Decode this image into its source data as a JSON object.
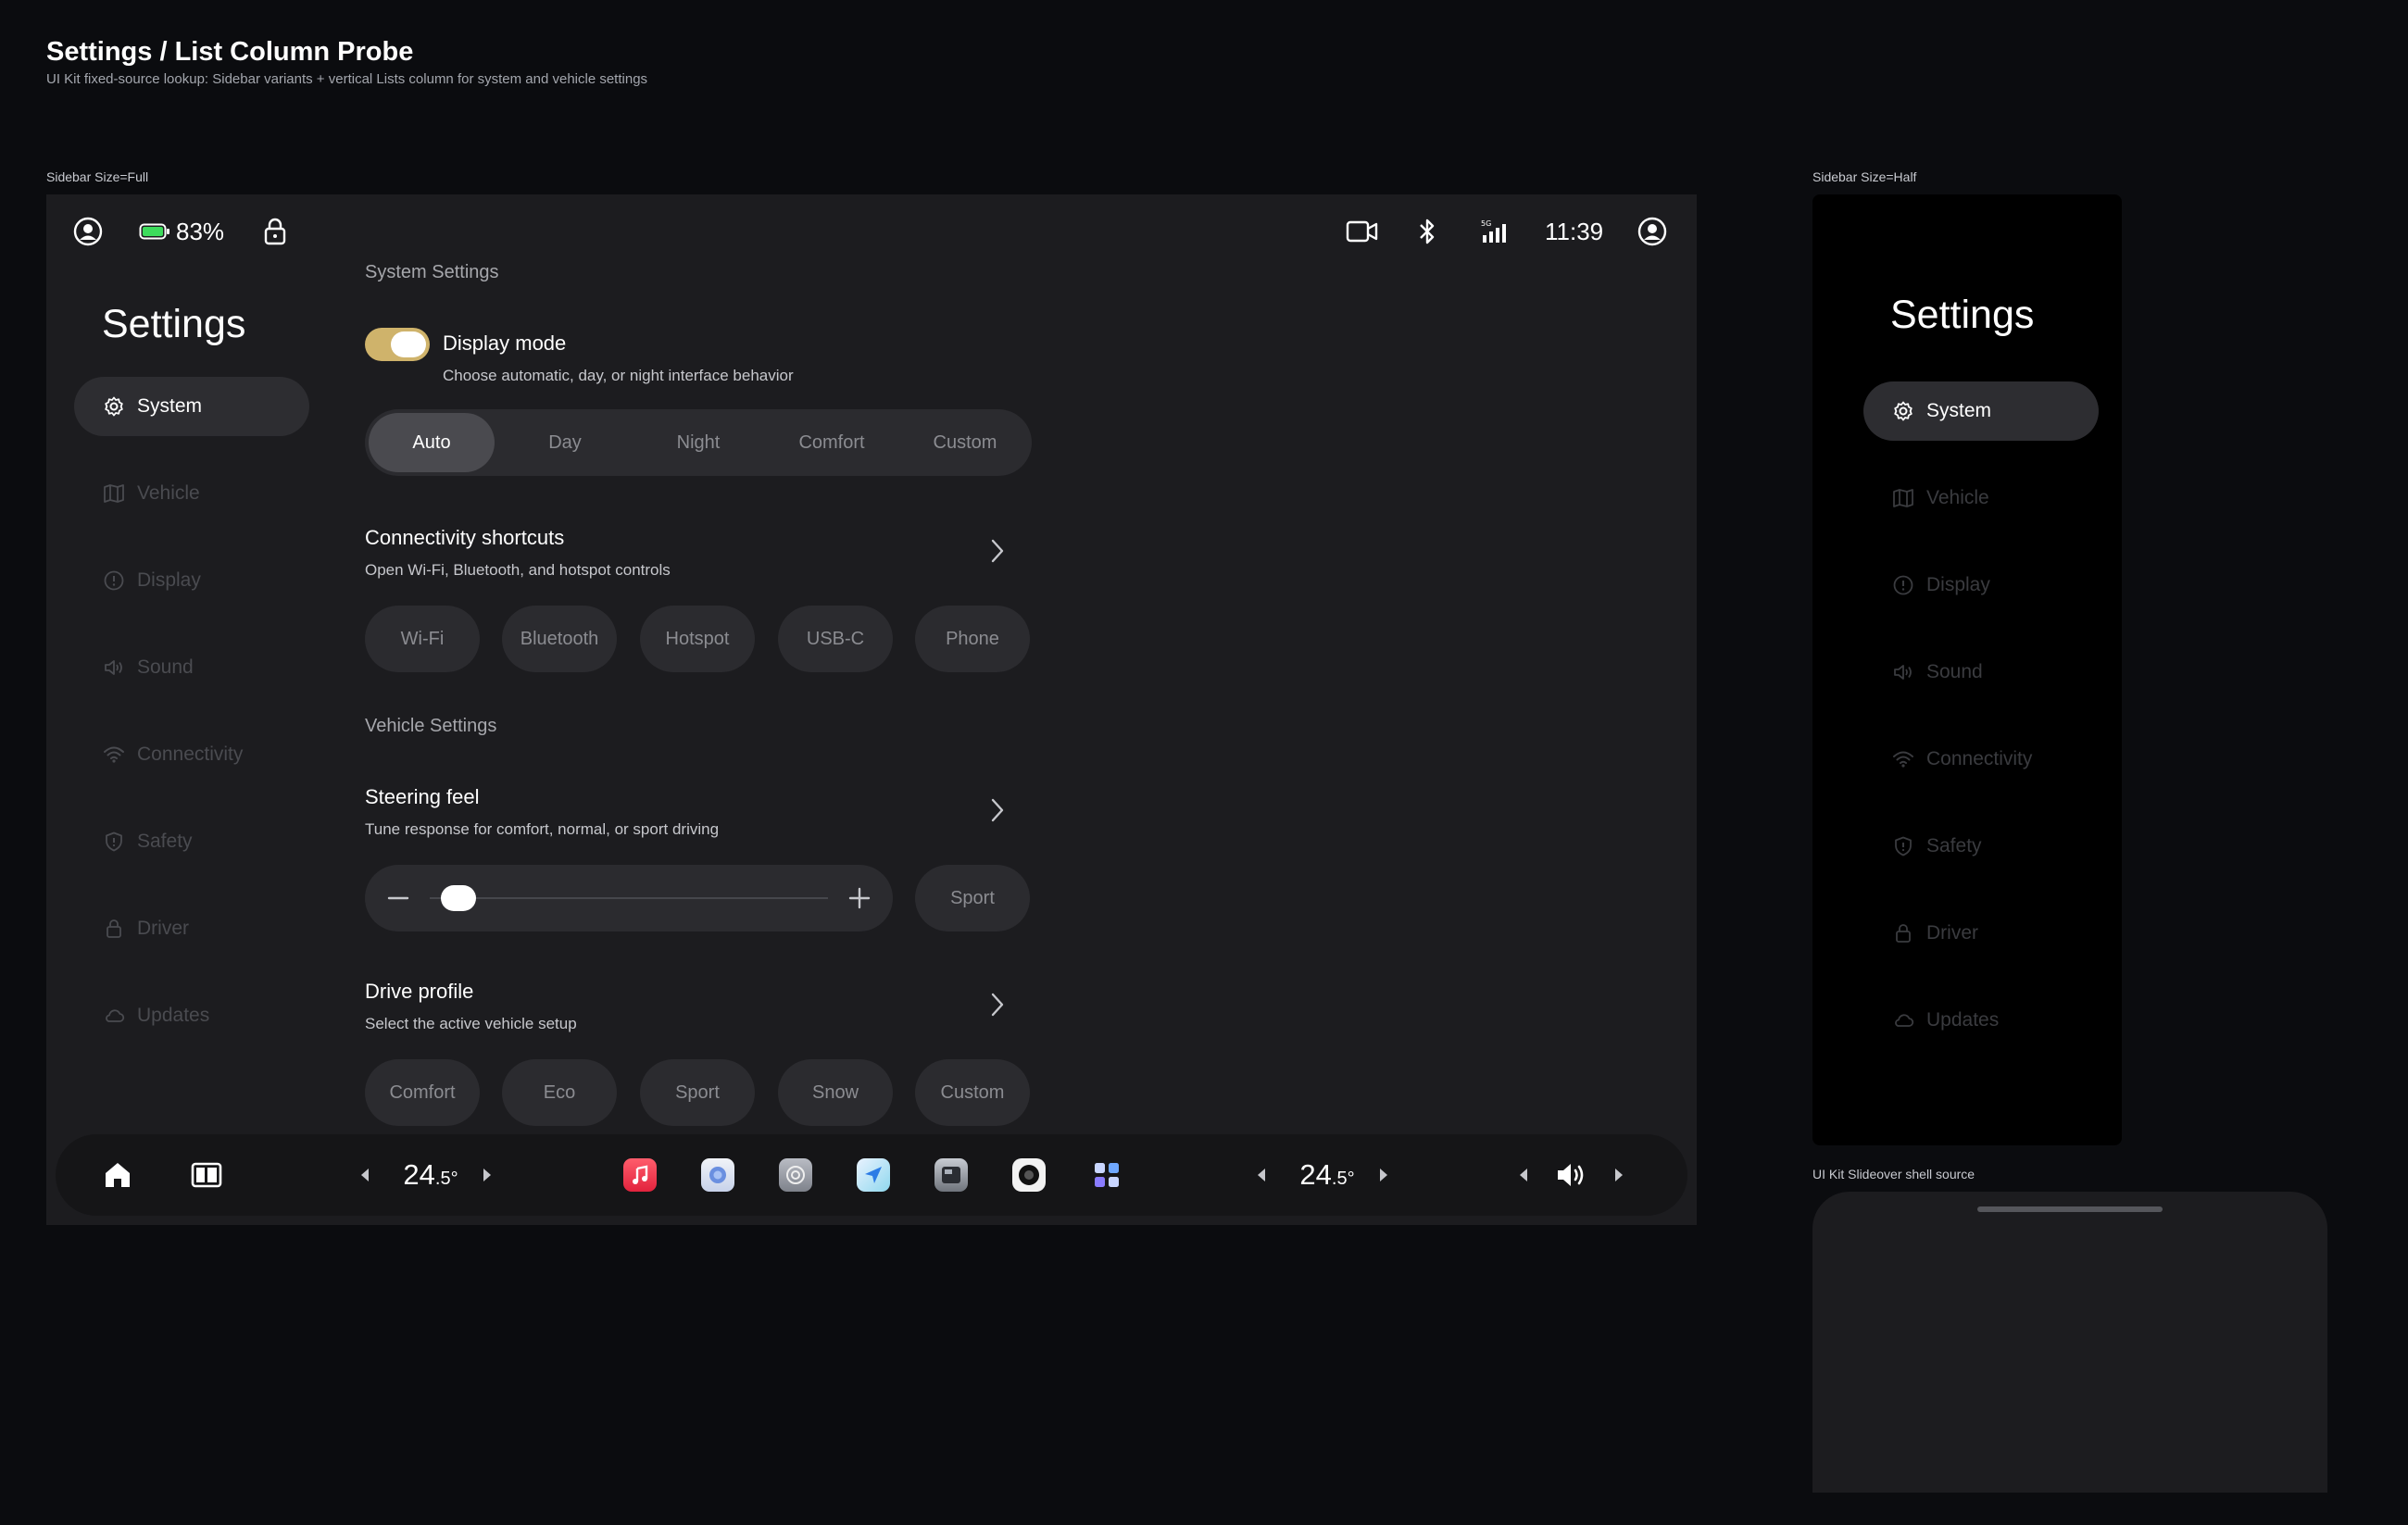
{
  "header": {
    "title": "Settings / List Column Probe",
    "subtitle": "UI Kit fixed-source lookup: Sidebar variants + vertical Lists column for system and vehicle settings"
  },
  "frames": {
    "full_label": "Sidebar Size=Full",
    "half_label": "Sidebar Size=Half",
    "slideover_label": "UI Kit Slideover shell source"
  },
  "status_bar": {
    "battery": "83%",
    "time": "11:39"
  },
  "sidebar": {
    "title": "Settings",
    "items": [
      {
        "label": "System",
        "icon": "gear-icon",
        "active": true
      },
      {
        "label": "Vehicle",
        "icon": "map-icon",
        "active": false
      },
      {
        "label": "Display",
        "icon": "info-icon",
        "active": false
      },
      {
        "label": "Sound",
        "icon": "speaker-icon",
        "active": false
      },
      {
        "label": "Connectivity",
        "icon": "wifi-icon",
        "active": false
      },
      {
        "label": "Safety",
        "icon": "shield-icon",
        "active": false
      },
      {
        "label": "Driver",
        "icon": "lock-icon",
        "active": false
      },
      {
        "label": "Updates",
        "icon": "cloud-icon",
        "active": false
      }
    ]
  },
  "main": {
    "system_section": "System Settings",
    "display_mode": {
      "title": "Display mode",
      "description": "Choose automatic, day, or night interface behavior",
      "toggle_on": true,
      "options": [
        "Auto",
        "Day",
        "Night",
        "Comfort",
        "Custom"
      ],
      "selected": "Auto"
    },
    "connectivity": {
      "title": "Connectivity shortcuts",
      "description": "Open Wi-Fi, Bluetooth, and hotspot controls",
      "chips": [
        "Wi-Fi",
        "Bluetooth",
        "Hotspot",
        "USB-C",
        "Phone"
      ]
    },
    "vehicle_section": "Vehicle Settings",
    "steering": {
      "title": "Steering feel",
      "description": "Tune response for comfort, normal, or sport driving",
      "slider_value": 0.03,
      "mode_chip": "Sport"
    },
    "drive_profile": {
      "title": "Drive profile",
      "description": "Select the active vehicle setup",
      "chips": [
        "Comfort",
        "Eco",
        "Sport",
        "Snow",
        "Custom"
      ]
    }
  },
  "dock": {
    "left_temp_main": "24",
    "left_temp_sub": ".5°",
    "right_temp_main": "24",
    "right_temp_sub": ".5°",
    "apps": [
      "music-app-icon",
      "browser-app-icon",
      "settings-app-icon",
      "navigation-app-icon",
      "media-app-icon",
      "camera-app-icon",
      "apps-grid-icon"
    ]
  }
}
